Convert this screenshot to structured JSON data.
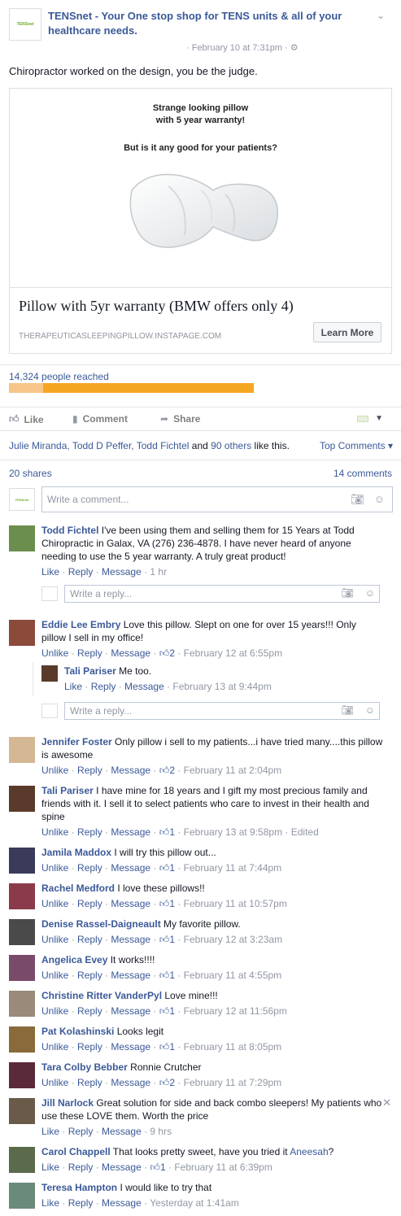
{
  "post": {
    "page_logo_text": "TENSnet",
    "page_name": "TENSnet - Your One stop shop for TENS units & all of your healthcare needs.",
    "time": "· February 10 at 7:31pm · ",
    "settings_icon": "gear-icon",
    "text": "Chiropractor worked on the design, you be the judge."
  },
  "card": {
    "image_line1": "Strange looking pillow",
    "image_line2": "with 5 year warranty!",
    "image_line3": "But is it any good for your patients?",
    "title": "Pillow with 5yr warranty (BMW offers only 4)",
    "domain": "THERAPEUTICASLEEPINGPILLOW.INSTAPAGE.COM",
    "button": "Learn More"
  },
  "reach": {
    "text": "14,324 people reached",
    "organic_fraction": 0.14
  },
  "actions": {
    "like": "Like",
    "comment": "Comment",
    "share": "Share"
  },
  "likes": {
    "names": "Julie Miranda, Todd D Peffer, Todd Fichtel",
    "and": " and ",
    "others": "90 others",
    "suffix": " like this.",
    "top_comments": "Top Comments ▾"
  },
  "stats": {
    "shares": "20 shares",
    "comments": "14 comments"
  },
  "write": {
    "placeholder": "Write a comment...",
    "reply_placeholder": "Write a reply..."
  },
  "colors": {
    "link": "#3b5998",
    "reach_paid": "#f5a623",
    "reach_organic": "#f7c58a"
  },
  "comments": [
    {
      "name": "Todd Fichtel",
      "text": " I've been using them and selling them for 15 Years at Todd Chiropractic in Galax, VA (276) 236-4878. I have never heard of anyone needing to use the 5 year warranty. A truly great product!",
      "action1": "Like",
      "likes": "",
      "time": "1 hr",
      "edited": ""
    },
    {
      "name": "Eddie Lee Embry",
      "text": " Love this pillow. Slept on one for over 15 years!!! Only pillow I sell in my office!",
      "action1": "Unlike",
      "likes": "2",
      "time": "February 12 at 6:55pm",
      "edited": ""
    },
    {
      "name": "Jennifer Foster",
      "text": " Only pillow i sell to my patients...i have tried many....this pillow is awesome",
      "action1": "Unlike",
      "likes": "2",
      "time": "February 11 at 2:04pm",
      "edited": ""
    },
    {
      "name": "Tali Pariser",
      "text": " I have mine for 18 years and I gift my most precious family and friends with it. I sell it to select patients who care to invest in their health and spine",
      "action1": "Unlike",
      "likes": "1",
      "time": "February 13 at 9:58pm",
      "edited": " · Edited"
    },
    {
      "name": "Jamila Maddox",
      "text": " I will try this pillow out...",
      "action1": "Unlike",
      "likes": "1",
      "time": "February 11 at 7:44pm",
      "edited": ""
    },
    {
      "name": "Rachel Medford",
      "text": " I love these pillows!!",
      "action1": "Unlike",
      "likes": "1",
      "time": "February 11 at 10:57pm",
      "edited": ""
    },
    {
      "name": "Denise Rassel-Daigneault",
      "text": " My favorite pillow.",
      "action1": "Unlike",
      "likes": "1",
      "time": "February 12 at 3:23am",
      "edited": ""
    },
    {
      "name": "Angelica Evey",
      "text": " It works!!!!",
      "action1": "Unlike",
      "likes": "1",
      "time": "February 11 at 4:55pm",
      "edited": ""
    },
    {
      "name": "Christine Ritter VanderPyl",
      "text": " Love mine!!!",
      "action1": "Unlike",
      "likes": "1",
      "time": "February 12 at 11:56pm",
      "edited": ""
    },
    {
      "name": "Pat Kolashinski",
      "text": " Looks legit",
      "action1": "Unlike",
      "likes": "1",
      "time": "February 11 at 8:05pm",
      "edited": ""
    },
    {
      "name": "Tara Colby Bebber",
      "text": " Ronnie Crutcher",
      "action1": "Unlike",
      "likes": "2",
      "time": "February 11 at 7:29pm",
      "edited": ""
    },
    {
      "name": "Jill Narlock",
      "text": " Great solution for side and back combo sleepers! My patients who use these LOVE them. Worth the price",
      "action1": "Like",
      "likes": "",
      "time": "9 hrs",
      "edited": ""
    },
    {
      "name": "Carol Chappell",
      "text": " That looks pretty sweet, have you tried it ",
      "tag": "Aneesah",
      "tail": "?",
      "action1": "Like",
      "likes": "1",
      "time": "February 11 at 6:39pm",
      "edited": ""
    },
    {
      "name": "Teresa Hampton",
      "text": " I would like to try that",
      "action1": "Like",
      "likes": "",
      "time": "Yesterday at 1:41am",
      "edited": ""
    }
  ],
  "reply": {
    "name": "Tali Pariser",
    "text": " Me too.",
    "action1": "Like",
    "time": "February 13 at 9:44pm"
  },
  "meta_labels": {
    "reply": "Reply",
    "message": "Message"
  }
}
